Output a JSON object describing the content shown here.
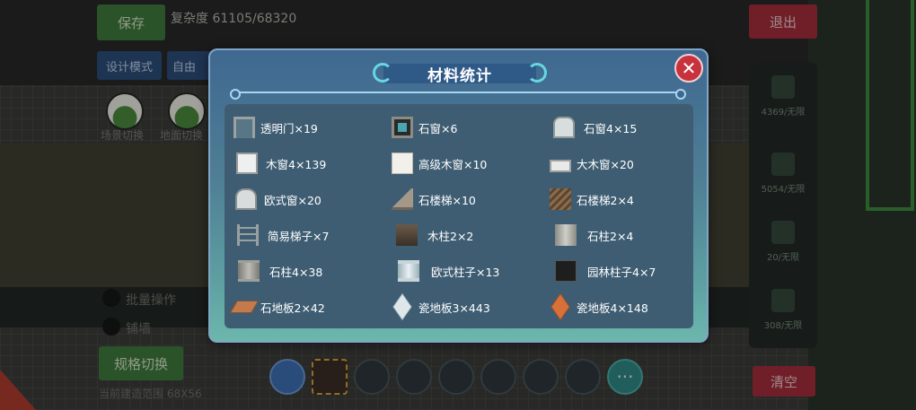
{
  "background": {
    "save_label": "保存",
    "complexity_label": "复杂度 61105/68320",
    "design_mode_label": "设计模式",
    "free_label": "自由",
    "exit_label": "退出",
    "clear_label": "清空",
    "spec_switch_label": "规格切换",
    "batch_label": "批量操作",
    "wall_label": "铺墙",
    "terrain_label_1": "场景切换",
    "terrain_label_2": "地面切换",
    "bottom_info": "当前建造范围 68X56",
    "right_panel": [
      {
        "count": "4369/无限"
      },
      {
        "count": "5054/无限"
      },
      {
        "count": "20/无限"
      },
      {
        "count": "308/无限"
      }
    ],
    "hotbar_more": "···"
  },
  "dialog": {
    "title": "材料统计",
    "close_glyph": "✕",
    "items": [
      {
        "label": "透明门×19",
        "icon": "clear-door-icon"
      },
      {
        "label": "石窗×6",
        "icon": "stone-window-icon"
      },
      {
        "label": "石窗4×15",
        "icon": "tall-stone-window-icon"
      },
      {
        "label": "木窗4×139",
        "icon": "wood-window-icon"
      },
      {
        "label": "高级木窗×10",
        "icon": "premium-wood-window-icon"
      },
      {
        "label": "大木窗×20",
        "icon": "large-wood-window-icon"
      },
      {
        "label": "欧式窗×20",
        "icon": "european-window-icon"
      },
      {
        "label": "石楼梯×10",
        "icon": "stone-stairs-icon"
      },
      {
        "label": "石楼梯2×4",
        "icon": "stone-stairs-2-icon"
      },
      {
        "label": "简易梯子×7",
        "icon": "simple-ladder-icon"
      },
      {
        "label": "木柱2×2",
        "icon": "wood-column-icon"
      },
      {
        "label": "石柱2×4",
        "icon": "stone-column-2-icon"
      },
      {
        "label": "石柱4×38",
        "icon": "stone-column-4-icon"
      },
      {
        "label": "欧式柱子×13",
        "icon": "european-column-icon"
      },
      {
        "label": "园林柱子4×7",
        "icon": "garden-column-icon"
      },
      {
        "label": "石地板2×42",
        "icon": "stone-floor-icon"
      },
      {
        "label": "瓷地板3×443",
        "icon": "tile-floor-3-icon"
      },
      {
        "label": "瓷地板4×148",
        "icon": "tile-floor-4-icon"
      }
    ]
  }
}
